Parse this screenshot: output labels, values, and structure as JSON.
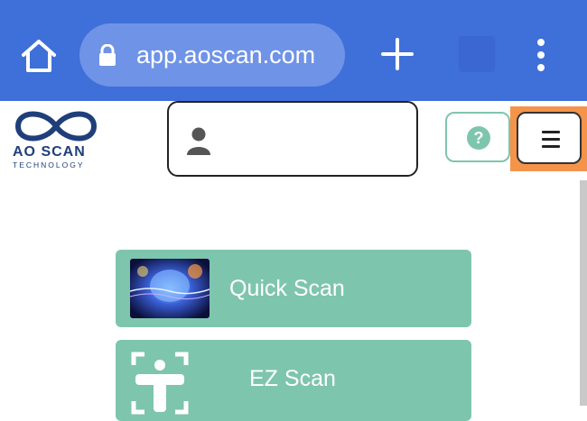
{
  "browser": {
    "url": "app.aoscan.com",
    "icons": [
      "home-icon",
      "lock-icon",
      "plus-icon",
      "tabs-icon",
      "more-vert-icon"
    ]
  },
  "header": {
    "logo_word": "AO SCAN",
    "logo_sub": "TECHNOLOGY",
    "help_label": "?",
    "icons": [
      "user-icon",
      "help-icon",
      "menu-icon"
    ]
  },
  "main": {
    "scans": [
      {
        "label": "Quick Scan",
        "icon": "brain-image"
      },
      {
        "label": "EZ Scan",
        "icon": "body-frame-icon"
      }
    ]
  },
  "colors": {
    "browser_bar": "#3f6fd9",
    "url_pill": "#6f93e6",
    "accent_green": "#7ec5ad",
    "highlight_orange": "#f4944a",
    "logo_blue": "#1f3f7a"
  }
}
